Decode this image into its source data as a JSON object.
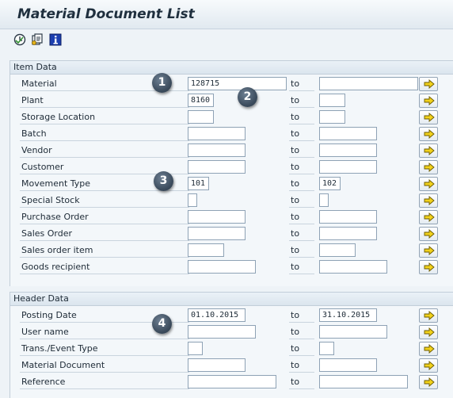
{
  "title": "Material Document List",
  "toolbar": {
    "icons": [
      "execute-icon",
      "get-variant-icon",
      "info-icon"
    ]
  },
  "item_data": {
    "header": "Item Data",
    "to_label": "to",
    "rows": [
      {
        "label": "Material",
        "from": "128715",
        "to": ""
      },
      {
        "label": "Plant",
        "from": "8160",
        "to": ""
      },
      {
        "label": "Storage Location",
        "from": "",
        "to": ""
      },
      {
        "label": "Batch",
        "from": "",
        "to": ""
      },
      {
        "label": "Vendor",
        "from": "",
        "to": ""
      },
      {
        "label": "Customer",
        "from": "",
        "to": ""
      },
      {
        "label": "Movement Type",
        "from": "101",
        "to": "102"
      },
      {
        "label": "Special Stock",
        "from": "",
        "to": ""
      },
      {
        "label": "Purchase Order",
        "from": "",
        "to": ""
      },
      {
        "label": "Sales Order",
        "from": "",
        "to": ""
      },
      {
        "label": "Sales order item",
        "from": "",
        "to": ""
      },
      {
        "label": "Goods recipient",
        "from": "",
        "to": ""
      }
    ]
  },
  "header_data": {
    "header": "Header Data",
    "to_label": "to",
    "rows": [
      {
        "label": "Posting Date",
        "from": "01.10.2015",
        "to": "31.10.2015"
      },
      {
        "label": "User name",
        "from": "",
        "to": ""
      },
      {
        "label": "Trans./Event Type",
        "from": "",
        "to": ""
      },
      {
        "label": "Material Document",
        "from": "",
        "to": ""
      },
      {
        "label": "Reference",
        "from": "",
        "to": ""
      }
    ]
  },
  "callouts": [
    "1",
    "2",
    "3",
    "4"
  ],
  "colors": {
    "arrow_fill": "#f2d21b",
    "badge": "#4a5a6b"
  }
}
